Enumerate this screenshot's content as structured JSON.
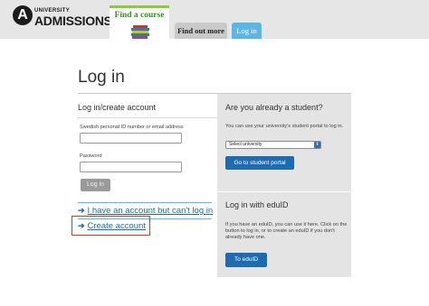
{
  "header": {
    "logo_letter": "A",
    "logo_small": "UNIVERSITY",
    "logo_main": "ADMISSIONS.SE",
    "tabs": [
      {
        "label": "Find a course"
      },
      {
        "label": "Find out more"
      },
      {
        "label": "Log in"
      }
    ]
  },
  "page": {
    "title": "Log in"
  },
  "left": {
    "title": "Log in/create account",
    "id_label": "Swedish personal ID number or email address",
    "id_value": "",
    "password_label": "Password",
    "password_value": "",
    "login_button": "Log in",
    "link_cant_login": "I have an account but can't log in",
    "link_create": "Create account"
  },
  "right": {
    "title": "Are you already a student?",
    "portal_text": "You can use your university's student portal to log in.",
    "select_value": "Select university",
    "portal_button": "Go to student portal",
    "eduid_title": "Log in with eduID",
    "eduid_text": "If you have an eduID, you can use it here. Click on the button to log in, or to create an eduID if you don't already have one.",
    "eduid_button": "To eduID"
  },
  "colors": {
    "accent_blue": "#5bb6e6",
    "button_blue": "#1f6bb0",
    "highlight_red": "#e8331c",
    "find_course_green": "#3a8a2e"
  }
}
